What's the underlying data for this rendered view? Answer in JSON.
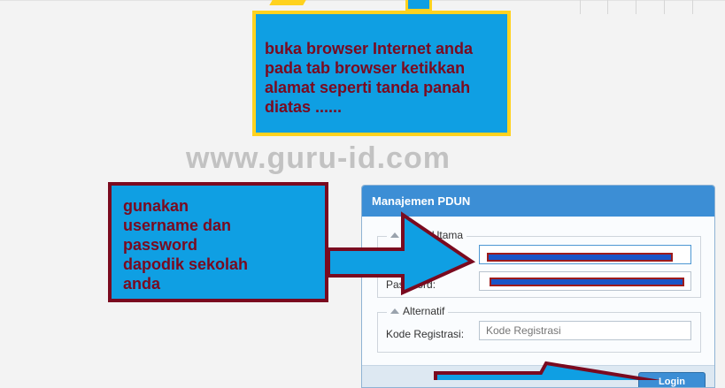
{
  "instructions": {
    "top_callout": [
      "buka browser Internet anda",
      "pada tab browser ketikkan",
      "alamat seperti tanda panah",
      "diatas ......"
    ],
    "left_callout": [
      "gunakan",
      "username dan",
      "password",
      "dapodik sekolah",
      "anda"
    ]
  },
  "watermark": "www.guru-id.com",
  "panel": {
    "title": "Manajemen PDUN",
    "login_utama": {
      "legend": "Login Utama",
      "username_label": "U",
      "password_label": "Password:"
    },
    "alternatif": {
      "legend": "Alternatif",
      "kode_label": "Kode Registrasi:",
      "kode_placeholder": "Kode Registrasi"
    },
    "login_button": "Login"
  },
  "colors": {
    "callout_blue": "#0f9fe3",
    "callout_text": "#7a0a1f",
    "panel_header": "#3c8ed5",
    "highlight_border": "#ffd21f",
    "callout_border": "#7a0a1f"
  }
}
